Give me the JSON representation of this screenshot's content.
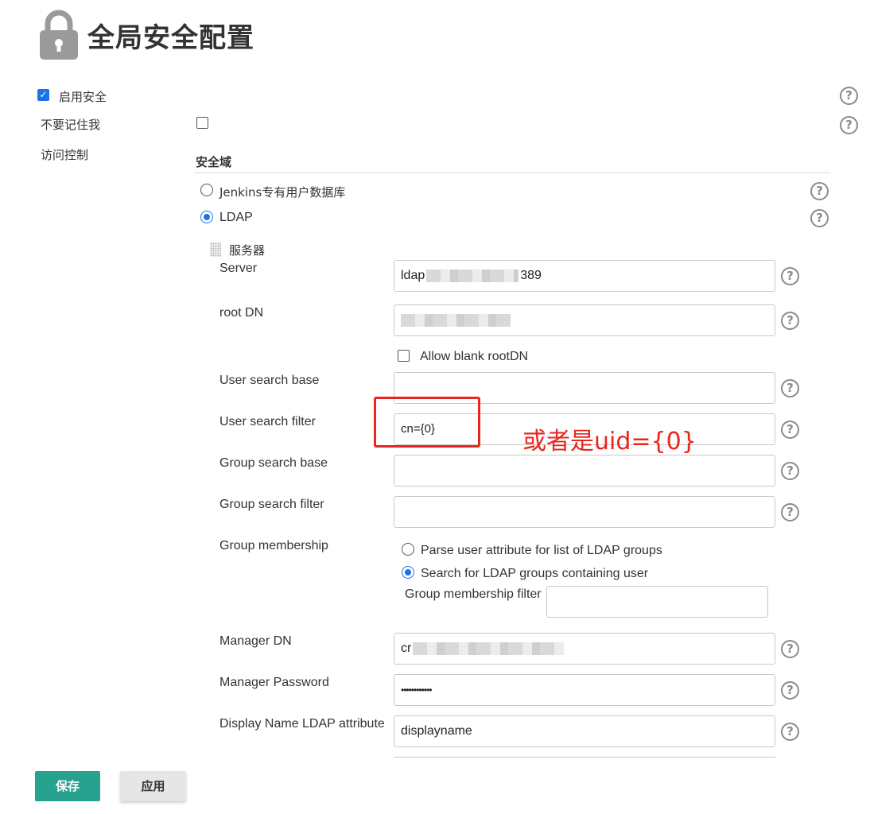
{
  "page": {
    "title": "全局安全配置",
    "icon": "lock-icon"
  },
  "general": {
    "enable_security_label": "启用安全",
    "enable_security_checked": true,
    "remember_me_label": "不要记住我",
    "remember_me_checked": false,
    "access_control_label": "访问控制"
  },
  "security_realm": {
    "heading": "安全域",
    "options": [
      {
        "label": "Jenkins专有用户数据库",
        "selected": false
      },
      {
        "label": "LDAP",
        "selected": true
      }
    ],
    "server_section_label": "服务器"
  },
  "ldap": {
    "server": {
      "label": "Server",
      "value": "ldap",
      "value_suffix": "389"
    },
    "root_dn": {
      "label": "root DN",
      "value": ""
    },
    "allow_blank_root_dn": {
      "label": "Allow blank rootDN",
      "checked": false
    },
    "user_search_base": {
      "label": "User search base",
      "value": ""
    },
    "user_search_filter": {
      "label": "User search filter",
      "value": "cn={0}"
    },
    "group_search_base": {
      "label": "Group search base",
      "value": ""
    },
    "group_search_filter": {
      "label": "Group search filter",
      "value": ""
    },
    "group_membership": {
      "label": "Group membership",
      "options": [
        {
          "label": "Parse user attribute for list of LDAP groups",
          "selected": false
        },
        {
          "label": "Search for LDAP groups containing user",
          "selected": true
        }
      ],
      "filter_label": "Group membership filter",
      "filter_value": ""
    },
    "manager_dn": {
      "label": "Manager DN",
      "value": "cr"
    },
    "manager_password": {
      "label": "Manager Password",
      "value": "••••••••••••"
    },
    "display_name_attr": {
      "label": "Display Name LDAP attribute",
      "value": "displayname"
    }
  },
  "annotation": {
    "text": "或者是uid={0}",
    "color": "#e8261c"
  },
  "footer": {
    "save_label": "保存",
    "apply_label": "应用",
    "save_color": "#26a28e"
  },
  "help_icon_glyph": "?"
}
